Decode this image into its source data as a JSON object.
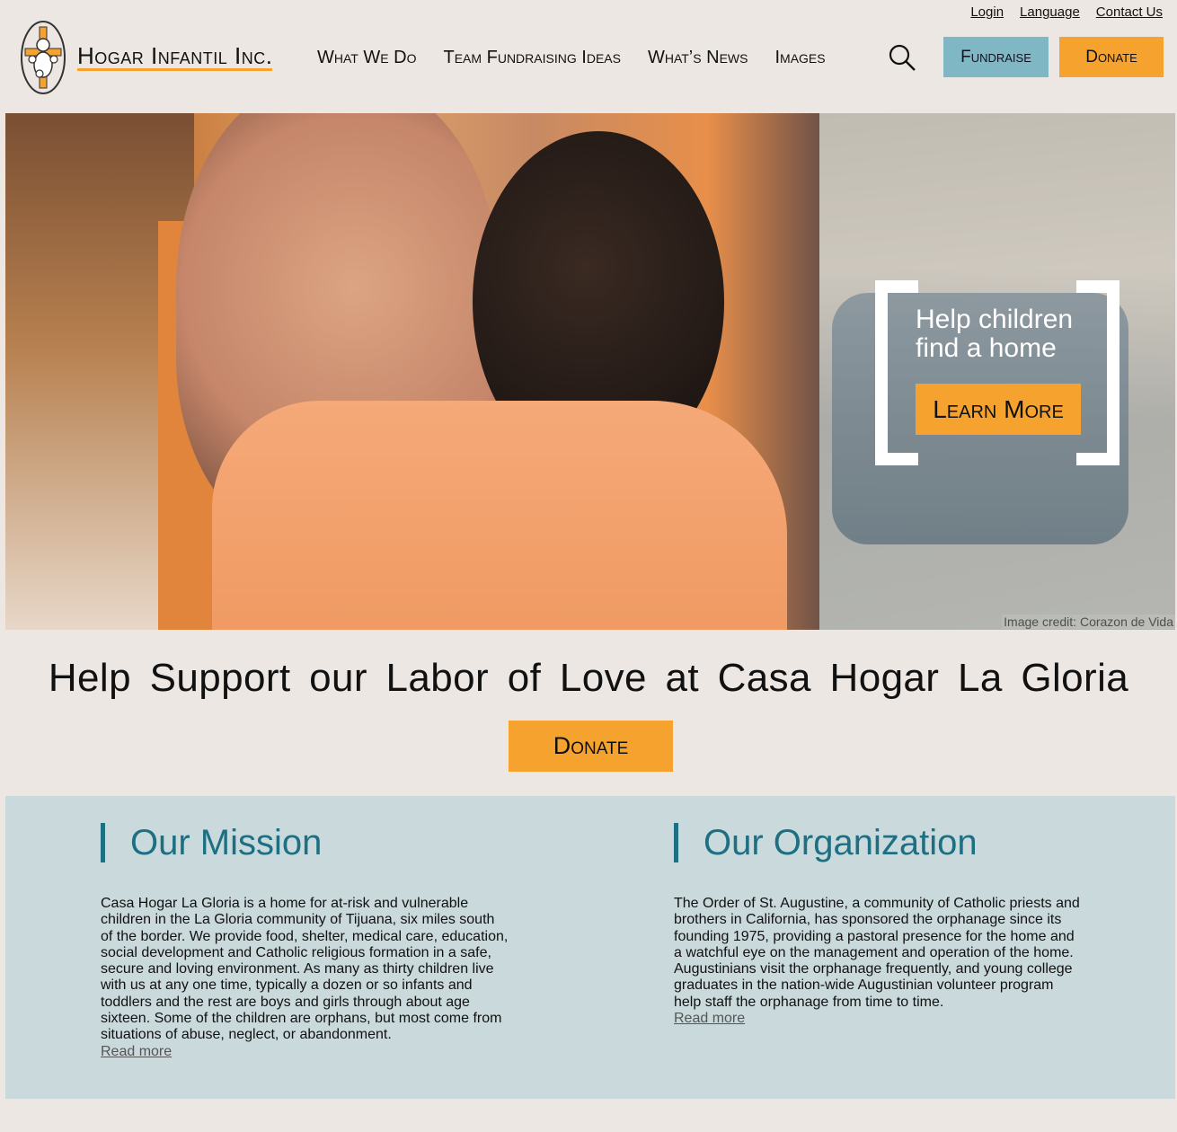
{
  "utility_links": {
    "login": "Login",
    "language": "Language",
    "contact": "Contact Us"
  },
  "brand": {
    "name": "Hogar Infantil Inc."
  },
  "nav": [
    "What We Do",
    "Team Fundraising Ideas",
    "What’s News",
    "Images"
  ],
  "header_buttons": {
    "fundraise": "Fundraise",
    "donate": "Donate"
  },
  "hero": {
    "headline_line1": "Help children",
    "headline_line2": "find a home",
    "cta": "Learn More",
    "credit": "Image credit: Corazon de Vida"
  },
  "tagline": "Help Support our Labor of Love at Casa Hogar La Gloria",
  "mid_donate": "Donate",
  "mission": {
    "title": "Our Mission",
    "text": "Casa Hogar La Gloria is a home for at-risk and vulnerable children in the La Gloria community of Tijuana, six miles south of the border. We provide food, shelter, medical care, education, social development and Catholic religious formation in a safe, secure and loving environment. As many as thirty children live with us at any one time, typically a dozen or so infants and toddlers and the rest are boys and girls through about age sixteen. Some of the children are orphans, but most come from situations of abuse, neglect, or abandonment.",
    "link": "Read more"
  },
  "organization": {
    "title": "Our Organization",
    "text": "The Order of St. Augustine, a community of Catholic priests and brothers in California, has sponsored the orphanage since its founding 1975, providing a pastoral presence for the home and a watchful eye on the management and operation of the home. Augustinians visit the orphanage frequently, and young college graduates in the nation-wide Augustinian volunteer program help staff the orphanage from time to time.",
    "link": "Read more"
  },
  "colors": {
    "accent_orange": "#f6a22f",
    "fundraise_blue": "#7fb7c4",
    "section_bg": "#cad9dc",
    "heading_teal": "#1d6f82",
    "page_bg": "#ece7e3"
  },
  "icons": {
    "search": "search-icon",
    "logo": "logo-emblem-icon"
  }
}
